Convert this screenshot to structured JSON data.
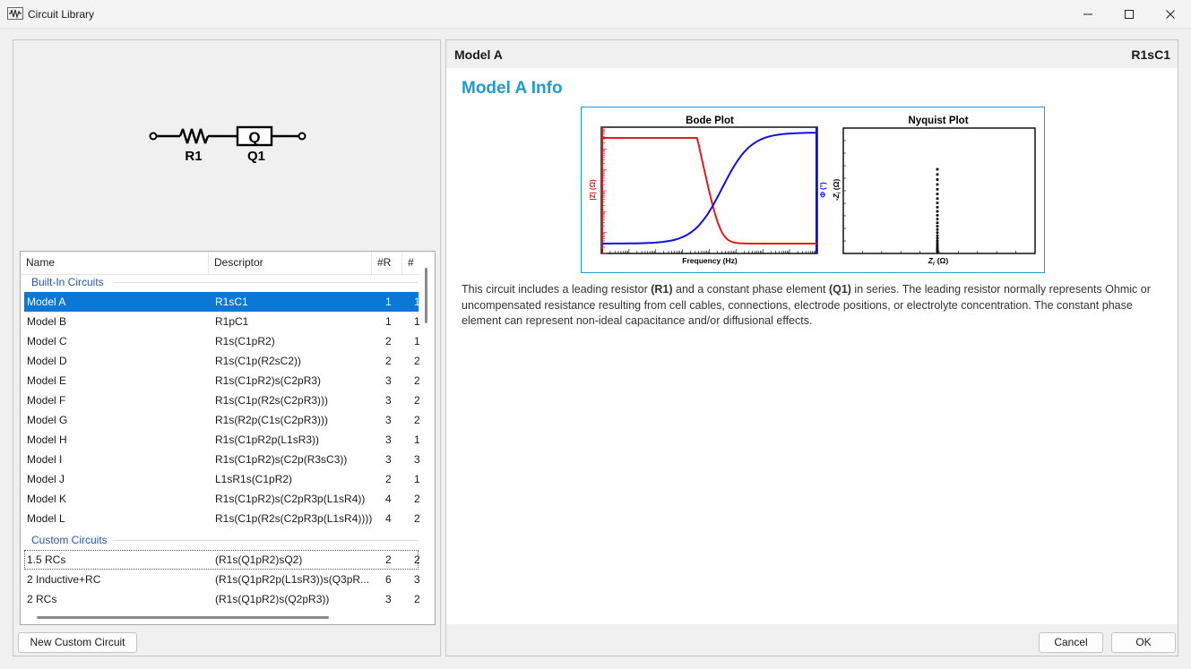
{
  "window": {
    "title": "Circuit Library",
    "app_icon": "waveform-icon",
    "controls": [
      "minimize-icon",
      "maximize-icon",
      "close-icon"
    ]
  },
  "schematic": {
    "labels": [
      "R1",
      "Q1"
    ],
    "element_letter": "Q"
  },
  "list": {
    "headers": [
      "Name",
      "Descriptor",
      "#R",
      "#"
    ],
    "groups": {
      "builtin": "Built-In Circuits",
      "custom": "Custom Circuits"
    },
    "builtin_rows": [
      {
        "name": "Model A",
        "descriptor": "R1sC1",
        "r": "1",
        "c": "1"
      },
      {
        "name": "Model B",
        "descriptor": "R1pC1",
        "r": "1",
        "c": "1"
      },
      {
        "name": "Model C",
        "descriptor": "R1s(C1pR2)",
        "r": "2",
        "c": "1"
      },
      {
        "name": "Model D",
        "descriptor": "R1s(C1p(R2sC2))",
        "r": "2",
        "c": "2"
      },
      {
        "name": "Model E",
        "descriptor": "R1s(C1pR2)s(C2pR3)",
        "r": "3",
        "c": "2"
      },
      {
        "name": "Model F",
        "descriptor": "R1s(C1p(R2s(C2pR3)))",
        "r": "3",
        "c": "2"
      },
      {
        "name": "Model G",
        "descriptor": "R1s(R2p(C1s(C2pR3)))",
        "r": "3",
        "c": "2"
      },
      {
        "name": "Model H",
        "descriptor": "R1s(C1pR2p(L1sR3))",
        "r": "3",
        "c": "1"
      },
      {
        "name": "Model I",
        "descriptor": "R1s(C1pR2)s(C2p(R3sC3))",
        "r": "3",
        "c": "3"
      },
      {
        "name": "Model J",
        "descriptor": "L1sR1s(C1pR2)",
        "r": "2",
        "c": "1"
      },
      {
        "name": "Model K",
        "descriptor": "R1s(C1pR2)s(C2pR3p(L1sR4))",
        "r": "4",
        "c": "2"
      },
      {
        "name": "Model L",
        "descriptor": "R1s(C1p(R2s(C2pR3p(L1sR4))))",
        "r": "4",
        "c": "2"
      }
    ],
    "custom_rows": [
      {
        "name": "1.5 RCs",
        "descriptor": "(R1s(Q1pR2)sQ2)",
        "r": "2",
        "c": "2"
      },
      {
        "name": "2 Inductive+RC",
        "descriptor": "(R1s(Q1pR2p(L1sR3))s(Q3pR...",
        "r": "6",
        "c": "3"
      },
      {
        "name": "2 RCs",
        "descriptor": "(R1s(Q1pR2)s(Q2pR3))",
        "r": "3",
        "c": "2"
      }
    ]
  },
  "buttons": {
    "new_custom": "New Custom Circuit",
    "cancel": "Cancel",
    "ok": "OK"
  },
  "info": {
    "model_title": "Model A",
    "descriptor": "R1sC1",
    "heading": "Model A Info",
    "text_parts": [
      "This circuit includes a leading resistor ",
      "(R1)",
      " and a constant phase element ",
      "(Q1)",
      " in series. The leading resistor normally represents Ohmic or uncompensated resistance resulting from cell cables, connections, electrode positions, or electrolyte concentration. The constant phase element can represent non-ideal capacitance and/or diffusional effects."
    ]
  },
  "plots": {
    "bode": {
      "title": "Bode Plot",
      "xlabel": "Frequency (Hz)",
      "ylabel_left": "|Z| (Ω)",
      "ylabel_right": "Φ (°)",
      "colors": {
        "magnitude": "#e8191b",
        "phase": "#1010e0"
      }
    },
    "nyquist": {
      "title": "Nyquist Plot",
      "xlabel_main": "Z",
      "xlabel_sub": "r",
      "xlabel_unit": " (Ω)",
      "ylabel_main": "-Z",
      "ylabel_sub": "i",
      "ylabel_unit": " (Ω)",
      "point_count": 26
    }
  },
  "colors": {
    "accent": "#1f9bd1",
    "selection": "#0a78d4",
    "group_text": "#2a56a8"
  }
}
